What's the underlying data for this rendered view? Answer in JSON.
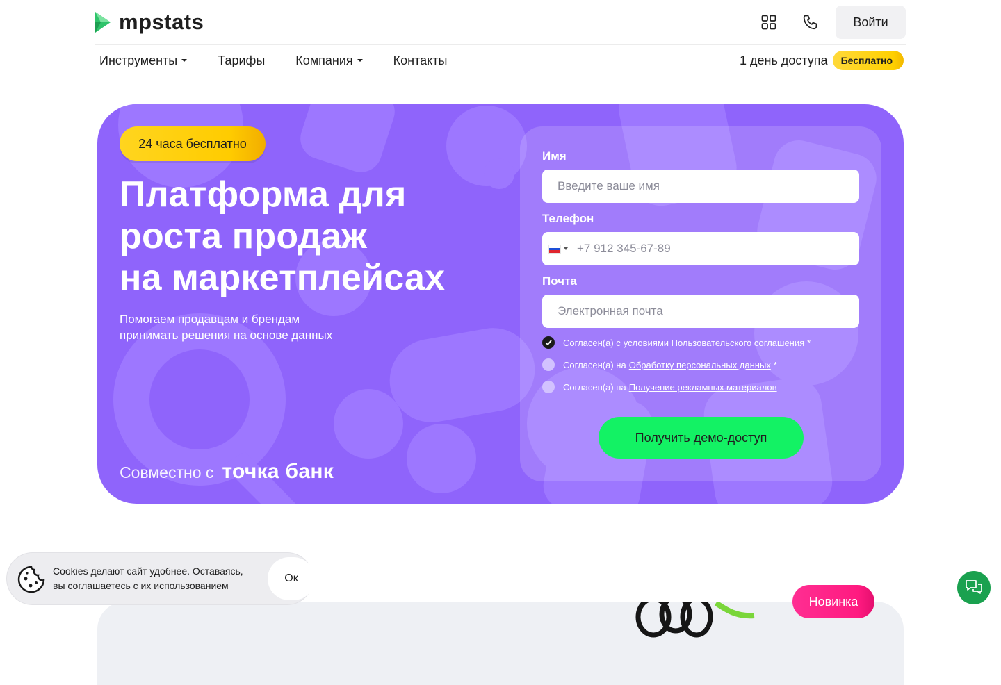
{
  "colors": {
    "brand_green": "#2ec36a",
    "hero_purple": "#8f64fb",
    "cta_green": "#13f264",
    "badge_yellow": "#ffcc00",
    "badge_pink": "#ff1a80",
    "chat_green": "#1aa14f"
  },
  "header": {
    "logo_text": "mpstats",
    "logo_icon": "play-triangle-logo-icon",
    "apps_icon": "grid-icon",
    "phone_icon": "phone-icon",
    "login_label": "Войти"
  },
  "nav": {
    "items": [
      {
        "label": "Инструменты",
        "dropdown": true
      },
      {
        "label": "Тарифы",
        "dropdown": false
      },
      {
        "label": "Компания",
        "dropdown": true
      },
      {
        "label": "Контакты",
        "dropdown": false
      }
    ],
    "access_text": "1 день доступа",
    "free_badge": "Бесплатно"
  },
  "hero": {
    "badge": "24 часа бесплатно",
    "title_lines": [
      "Платформа для",
      "роста продаж",
      "на маркетплейсах"
    ],
    "subtitle_lines": [
      "Помогаем продавцам и брендам",
      "принимать решения на основе данных"
    ],
    "partner_prefix": "Совместно с",
    "partner_brand": "точка банк"
  },
  "form": {
    "name_label": "Имя",
    "name_placeholder": "Введите ваше имя",
    "phone_label": "Телефон",
    "phone_placeholder": "+7 912 345-67-89",
    "phone_country_icon": "russia-flag-icon",
    "email_label": "Почта",
    "email_placeholder": "Электронная почта",
    "consents": [
      {
        "prefix": "Согласен(а) с",
        "link": "условиями Пользовательского соглашения",
        "required": "*",
        "checked": true
      },
      {
        "prefix": "Согласен(а) на",
        "link": "Обработку персональных данных",
        "required": "*",
        "checked": false
      },
      {
        "prefix": "Согласен(а) на",
        "link": "Получение рекламных материалов",
        "required": "",
        "checked": false
      }
    ],
    "submit_label": "Получить демо-доступ"
  },
  "cookie": {
    "icon": "cookie-icon",
    "text_lines": [
      "Cookies делают сайт удобнее. Оставаясь,",
      "вы соглашаетесь с их использованием"
    ],
    "ok_label": "Ок"
  },
  "new_badge": "Новинка",
  "chat_icon": "chat-bubbles-icon"
}
